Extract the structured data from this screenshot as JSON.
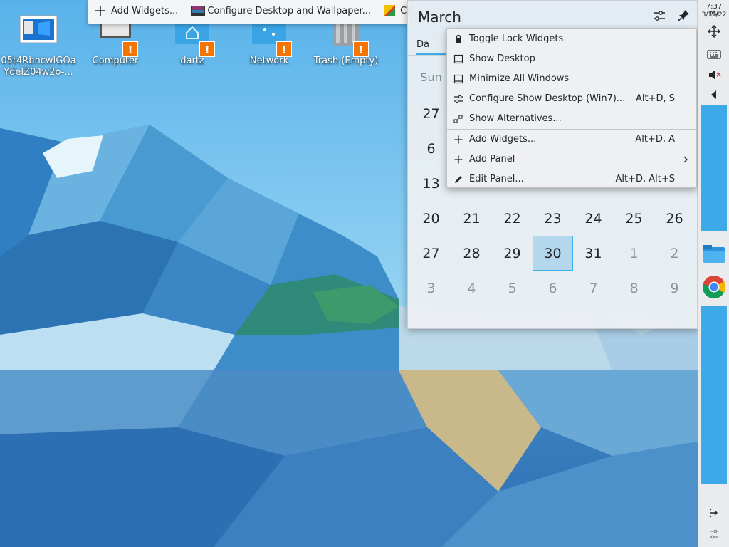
{
  "toolbar": {
    "add_widgets": "Add Widgets...",
    "configure_desktop": "Configure Desktop and Wallpaper...",
    "choose": "Choos"
  },
  "desktop_icons": [
    {
      "label": "05t4RbncwIGOaYdeIZ04w2o-...",
      "icon": "image-file-icon",
      "warning": false
    },
    {
      "label": "Computer",
      "icon": "computer-icon",
      "warning": true
    },
    {
      "label": "dartz",
      "icon": "home-folder-icon",
      "warning": true
    },
    {
      "label": "Network",
      "icon": "network-folder-icon",
      "warning": true
    },
    {
      "label": "Trash (Empty)",
      "icon": "trash-icon",
      "warning": true
    }
  ],
  "calendar": {
    "month": "March",
    "tab_label": "Da",
    "weekday_first": "Sun",
    "rows": [
      [
        {
          "d": "27",
          "dim": false
        }
      ],
      [
        {
          "d": "6",
          "dim": false
        }
      ],
      [
        {
          "d": "13",
          "dim": false
        }
      ],
      [
        {
          "d": "20"
        },
        {
          "d": "21"
        },
        {
          "d": "22"
        },
        {
          "d": "23"
        },
        {
          "d": "24"
        },
        {
          "d": "25"
        },
        {
          "d": "26"
        }
      ],
      [
        {
          "d": "27"
        },
        {
          "d": "28"
        },
        {
          "d": "29"
        },
        {
          "d": "30",
          "today": true
        },
        {
          "d": "31"
        },
        {
          "d": "1",
          "dim": true
        },
        {
          "d": "2",
          "dim": true
        }
      ],
      [
        {
          "d": "3",
          "dim": true
        },
        {
          "d": "4",
          "dim": true
        },
        {
          "d": "5",
          "dim": true
        },
        {
          "d": "6",
          "dim": true
        },
        {
          "d": "7",
          "dim": true
        },
        {
          "d": "8",
          "dim": true
        },
        {
          "d": "9",
          "dim": true
        }
      ]
    ]
  },
  "context_menu": {
    "items": [
      {
        "label": "Toggle Lock Widgets",
        "shortcut": "",
        "icon": "lock-icon"
      },
      {
        "label": "Show Desktop",
        "shortcut": "",
        "icon": "window-icon"
      },
      {
        "label": "Minimize All Windows",
        "shortcut": "",
        "icon": "window-icon"
      },
      {
        "label": "Configure Show Desktop (Win7)...",
        "shortcut": "Alt+D, S",
        "icon": "configure-icon"
      },
      {
        "label": "Show Alternatives...",
        "shortcut": "",
        "icon": "alternatives-icon"
      },
      {
        "separator": true
      },
      {
        "label": "Add Widgets...",
        "shortcut": "Alt+D, A",
        "icon": "plus-icon"
      },
      {
        "label": "Add Panel",
        "shortcut": "",
        "icon": "plus-icon",
        "submenu": true
      },
      {
        "label": "Edit Panel...",
        "shortcut": "Alt+D, Alt+S",
        "icon": "pencil-icon"
      }
    ]
  },
  "panel": {
    "time": "7:37 PM",
    "date": "3/30/22"
  }
}
